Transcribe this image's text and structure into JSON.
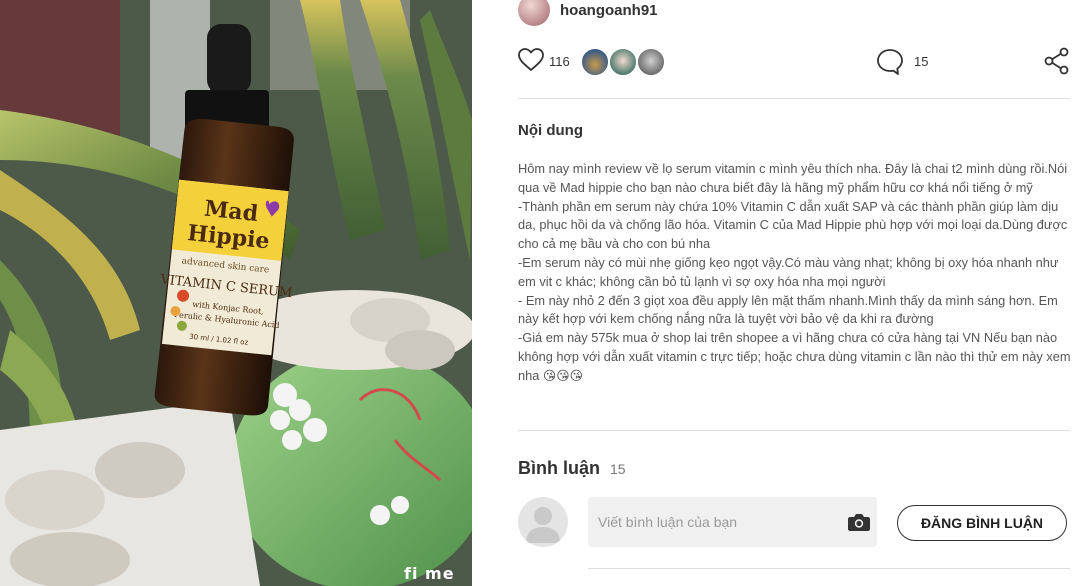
{
  "photo": {
    "watermark": "fi me",
    "bottle_label": {
      "brand": "Mad Hippie",
      "tagline": "advanced skin care",
      "product": "VITAMIN C SERUM",
      "ingredients": "with Konjac Root, Ferulic & Hyaluronic Acid",
      "volume": "30 ml / 1.02 fl oz"
    }
  },
  "author": {
    "username": "hoangoanh91"
  },
  "actions": {
    "like_count": "116",
    "comment_count": "15",
    "icons": [
      "heart-icon",
      "comment-icon",
      "share-icon"
    ]
  },
  "content": {
    "title": "Nội dung",
    "paragraphs": [
      "Hôm nay mình review về lọ serum vitamin c mình yêu thích nha. Đây là chai t2 mình dùng rồi.Nói qua về Mad hippie cho bạn nào chưa biết đây là hãng mỹ phẩm hữu cơ khá nổi tiếng ở mỹ",
      "-Thành phần em serum này chứa 10% Vitamin C dẫn xuất SAP và các thành phần giúp làm dịu da, phục hồi da và chống lão hóa. Vitamin C của Mad Hippie phù hợp với mọi loại da.Dùng được cho cả mẹ bầu và cho con bú nha",
      "-Em serum này có mùi nhẹ giống kẹo ngọt vậy.Có màu vàng nhạt; không bị oxy hóa nhanh như em vit c khác; không cần bỏ tủ lạnh vì sợ oxy hóa nha mọi người",
      "- Em này nhỏ 2 đến 3 giọt xoa đều apply lên mặt thấm nhanh.Mình thấy da mình sáng hơn. Em này kết hợp với kem chống nắng nữa là tuyệt vời bảo vệ da khi ra đường",
      "-Giá em này 575k mua ở shop lai trên shopee a vì hãng chưa có cửa hàng tại VN Nếu bạn nào không hợp với dẫn xuất vitamin c trực tiếp; hoặc chưa dùng vitamin c lần nào thì thử em này xem nha 😘😘😘"
    ]
  },
  "comments": {
    "title": "Bình luận",
    "count": "15",
    "input_placeholder": "Viết bình luận của bạn",
    "post_button": "ĐĂNG BÌNH LUẬN"
  }
}
